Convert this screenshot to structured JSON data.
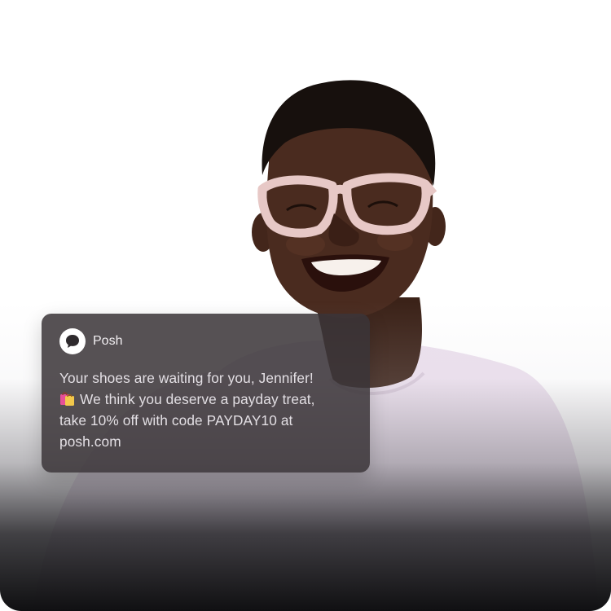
{
  "notification": {
    "app_name": "Posh",
    "app_icon": "chat-bubble-icon",
    "lines": [
      "Your shoes are waiting for you, Jennifer!",
      "We think you deserve a payday treat,",
      "take 10% off with code PAYDAY10 at",
      "posh.com"
    ],
    "emoji": "shopping-bags-icon"
  },
  "colors": {
    "notification_background": "#3a3438",
    "notification_text": "#e3dfe4",
    "shirt": "#ece0ee",
    "glasses": "#e7c8c6"
  }
}
